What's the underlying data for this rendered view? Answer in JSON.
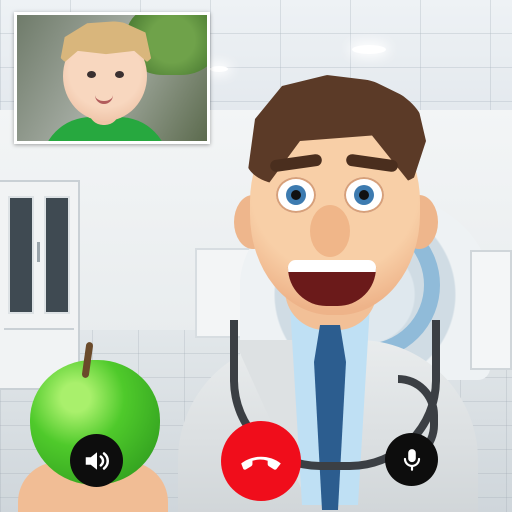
{
  "screen": "video-call",
  "colors": {
    "end_call_button": "#f00d1b",
    "control_button": "#0d0d0d",
    "icon": "#ffffff"
  },
  "participants": {
    "caller": "cartoon doctor",
    "self_preview": "child"
  },
  "controls": [
    {
      "id": "speaker",
      "icon": "speaker-icon"
    },
    {
      "id": "end_call",
      "icon": "phone-hangup-icon"
    },
    {
      "id": "microphone",
      "icon": "microphone-icon"
    }
  ]
}
